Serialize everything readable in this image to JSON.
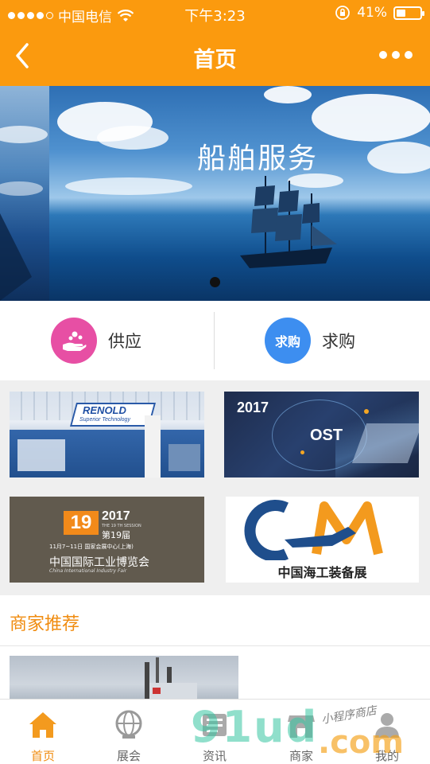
{
  "status_bar": {
    "carrier": "中国电信",
    "time": "下午3:23",
    "battery": "41%",
    "battery_level": 0.41
  },
  "navbar": {
    "title": "首页",
    "back_icon": "chevron-left-icon",
    "more_icon": "more-dots-icon"
  },
  "banner": {
    "title": "船舶服务",
    "slide_index": 1
  },
  "quick_actions": {
    "supply": {
      "label": "供应",
      "icon": "hand-give-icon",
      "color": "#e74fa4"
    },
    "demand": {
      "label": "求购",
      "badge": "求购",
      "color": "#3d8ef0"
    }
  },
  "tiles": {
    "renold": {
      "brand": "RENOLD",
      "tagline": "Superior Technology"
    },
    "ost": {
      "year": "2017",
      "brand": "OST"
    },
    "ciif": {
      "session": "19",
      "year": "2017",
      "session_text": "THE 19 TH SESSION",
      "edition": "第19届",
      "dates": "11月7~11日 国家会展中心(上海)",
      "name_cn": "中国国际工业博览会",
      "name_en": "China International Industry Fair"
    },
    "cm": {
      "logo": "CM",
      "caption": "中国海工装备展"
    }
  },
  "merchants": {
    "heading": "商家推荐"
  },
  "tabbar": {
    "items": [
      {
        "label": "首页",
        "icon": "home-icon",
        "active": true
      },
      {
        "label": "展会",
        "icon": "globe-icon",
        "active": false
      },
      {
        "label": "资讯",
        "icon": "news-icon",
        "active": false
      },
      {
        "label": "商家",
        "icon": "store-icon",
        "active": false
      },
      {
        "label": "我的",
        "icon": "user-icon",
        "active": false
      }
    ]
  },
  "watermark": {
    "logo_text": "91ud",
    "dotcom": ".com",
    "caption": "小程序商店"
  },
  "colors": {
    "brand": "#fb9a0e",
    "accent_text": "#f08c10"
  }
}
